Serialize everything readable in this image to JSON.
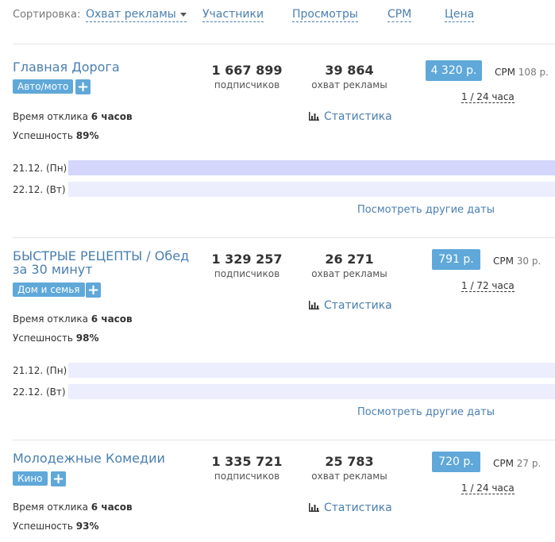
{
  "sort": {
    "label": "Сортировка:",
    "options": [
      "Охват рекламы",
      "Участники",
      "Просмотры",
      "CPM",
      "Цена"
    ]
  },
  "colors": {
    "accent": "#5fa8d9",
    "link": "#4a7fb0",
    "bar_busy": "#d4d6fb",
    "bar_free": "#ecedfd"
  },
  "channels": [
    {
      "title": "Главная Дорога",
      "tag": "Авто/мото",
      "subscribers": "1 667 899",
      "subscribers_label": "подписчиков",
      "reach": "39 864",
      "reach_label": "охват рекламы",
      "price": "4 320 р.",
      "cpm_label": "CPM",
      "cpm_value": "108 р.",
      "period": "1 / 24 часа",
      "response_label": "Время отклика",
      "response_value": "6 часов",
      "success_label": "Успешность",
      "success_value": "89%",
      "stats_label": "Статистика",
      "dates": [
        {
          "label": "21.12. (Пн)"
        },
        {
          "label": "22.12. (Вт)"
        }
      ],
      "more_dates": "Посмотреть другие даты"
    },
    {
      "title": "БЫСТРЫЕ РЕЦЕПТЫ / Обед за 30 минут",
      "tag": "Дом и семья",
      "subscribers": "1 329 257",
      "subscribers_label": "подписчиков",
      "reach": "26 271",
      "reach_label": "охват рекламы",
      "price": "791 р.",
      "cpm_label": "CPM",
      "cpm_value": "30 р.",
      "period": "1 / 72 часа",
      "response_label": "Время отклика",
      "response_value": "6 часов",
      "success_label": "Успешность",
      "success_value": "98%",
      "stats_label": "Статистика",
      "dates": [
        {
          "label": "21.12. (Пн)"
        },
        {
          "label": "22.12. (Вт)"
        }
      ],
      "more_dates": "Посмотреть другие даты"
    },
    {
      "title": "Молодежные Комедии",
      "tag": "Кино",
      "subscribers": "1 335 721",
      "subscribers_label": "подписчиков",
      "reach": "25 783",
      "reach_label": "охват рекламы",
      "price": "720 р.",
      "cpm_label": "CPM",
      "cpm_value": "27 р.",
      "period": "1 / 24 часа",
      "response_label": "Время отклика",
      "response_value": "6 часов",
      "success_label": "Успешность",
      "success_value": "93%",
      "stats_label": "Статистика"
    }
  ]
}
